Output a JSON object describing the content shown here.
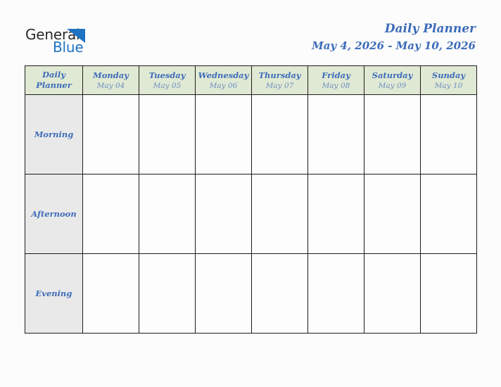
{
  "brand": {
    "word_one": "General",
    "word_two": "Blue",
    "triangle_icon": "triangle-icon",
    "accent_blue": "#1d72c2",
    "text_dark": "#2b2b2b"
  },
  "header": {
    "title": "Daily Planner",
    "date_range": "May 4, 2026 - May 10, 2026",
    "title_color": "#3d6cb9"
  },
  "table": {
    "corner_label_line1": "Daily",
    "corner_label_line2": "Planner",
    "header_bg": "#e0e9d3",
    "rowlabel_bg": "#e9e9e9",
    "border_color": "#1c1c1c",
    "columns": [
      {
        "day": "Monday",
        "date": "May 04"
      },
      {
        "day": "Tuesday",
        "date": "May 05"
      },
      {
        "day": "Wednesday",
        "date": "May 06"
      },
      {
        "day": "Thursday",
        "date": "May 07"
      },
      {
        "day": "Friday",
        "date": "May 08"
      },
      {
        "day": "Saturday",
        "date": "May 09"
      },
      {
        "day": "Sunday",
        "date": "May 10"
      }
    ],
    "rows": [
      {
        "label": "Morning",
        "cells": [
          "",
          "",
          "",
          "",
          "",
          "",
          ""
        ]
      },
      {
        "label": "Afternoon",
        "cells": [
          "",
          "",
          "",
          "",
          "",
          "",
          ""
        ]
      },
      {
        "label": "Evening",
        "cells": [
          "",
          "",
          "",
          "",
          "",
          "",
          ""
        ]
      }
    ]
  }
}
